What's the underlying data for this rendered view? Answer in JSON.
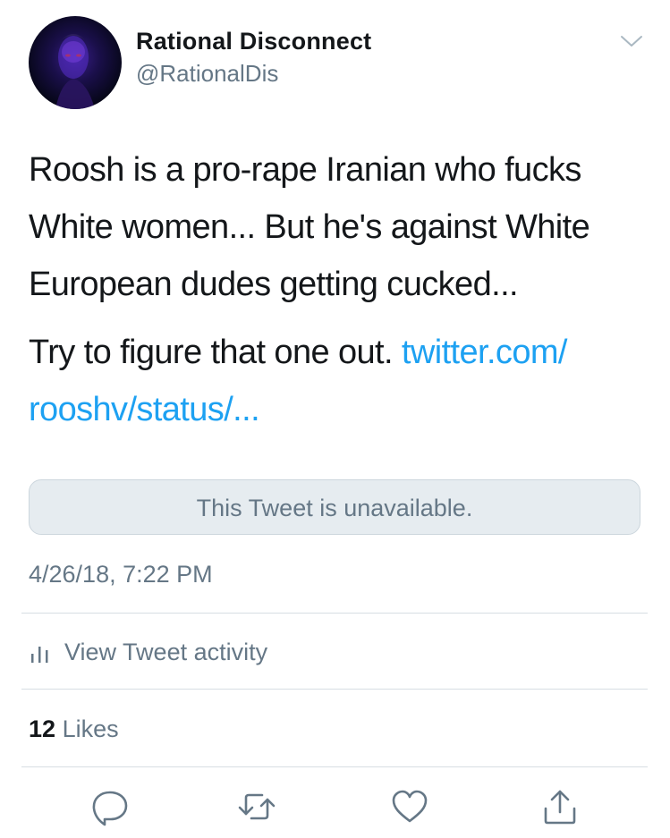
{
  "user": {
    "display_name": "Rational Disconnect",
    "handle": "@RationalDis"
  },
  "tweet": {
    "paragraph1": "Roosh is a pro-rape Iranian who fucks White women... But he's against White European dudes getting cucked...",
    "paragraph2_text": "Try to figure that one out. ",
    "link_line1": "twitter.com/",
    "link_line2": "rooshv/status/..."
  },
  "quote": {
    "unavailable_text": "This Tweet is unavailable."
  },
  "timestamp": "4/26/18, 7:22 PM",
  "activity": {
    "label": "View Tweet activity",
    "icon": "bar-chart-icon"
  },
  "likes": {
    "count": "12",
    "label": "Likes"
  },
  "actions": [
    {
      "icon": "reply-icon"
    },
    {
      "icon": "retweet-icon"
    },
    {
      "icon": "heart-icon"
    },
    {
      "icon": "share-icon"
    }
  ],
  "colors": {
    "link": "#1da1f2",
    "secondary_text": "#657786",
    "primary_text": "#14171a",
    "divider": "#d7dee3"
  }
}
